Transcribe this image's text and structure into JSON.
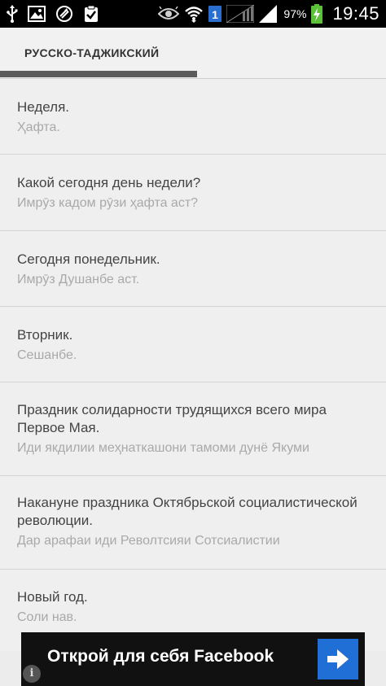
{
  "status_bar": {
    "battery_percent": "97%",
    "time": "19:45",
    "sim_badge": "1",
    "left_icons": [
      "usb-icon",
      "image-icon",
      "sync-icon",
      "clipboard-check-icon"
    ],
    "right_icons": [
      "eye-icon",
      "wifi-icon",
      "sim-icon",
      "signal-empty-icon",
      "signal-icon",
      "battery-charging-icon"
    ]
  },
  "header": {
    "tab_label": "РУССКО-ТАДЖИКСКИЙ"
  },
  "phrases": [
    {
      "ru": "Неделя.",
      "tj": "Ҳафта."
    },
    {
      "ru": "Какой сегодня день недели?",
      "tj": "Имрӯз кадом рӯзи ҳафта аст?"
    },
    {
      "ru": "Сегодня понедельник.",
      "tj": "Имрӯз Душанбе аст."
    },
    {
      "ru": "Вторник.",
      "tj": "Сешанбе."
    },
    {
      "ru": "Праздник солидарности трудящихся всего мира Первое Мая.",
      "tj": "Иди якдилии меҳнаткашони тамоми дунё Якуми"
    },
    {
      "ru": "Накануне праздника Октябрьской социалистической революции.",
      "tj": "Дар арафаи иди Револтсияи Сотсиалистии"
    },
    {
      "ru": "Новый год.",
      "tj": "Соли нав."
    }
  ],
  "ad": {
    "text": "Открой для себя Facebook",
    "info_label": "i",
    "button_color": "#1f6fd6"
  }
}
